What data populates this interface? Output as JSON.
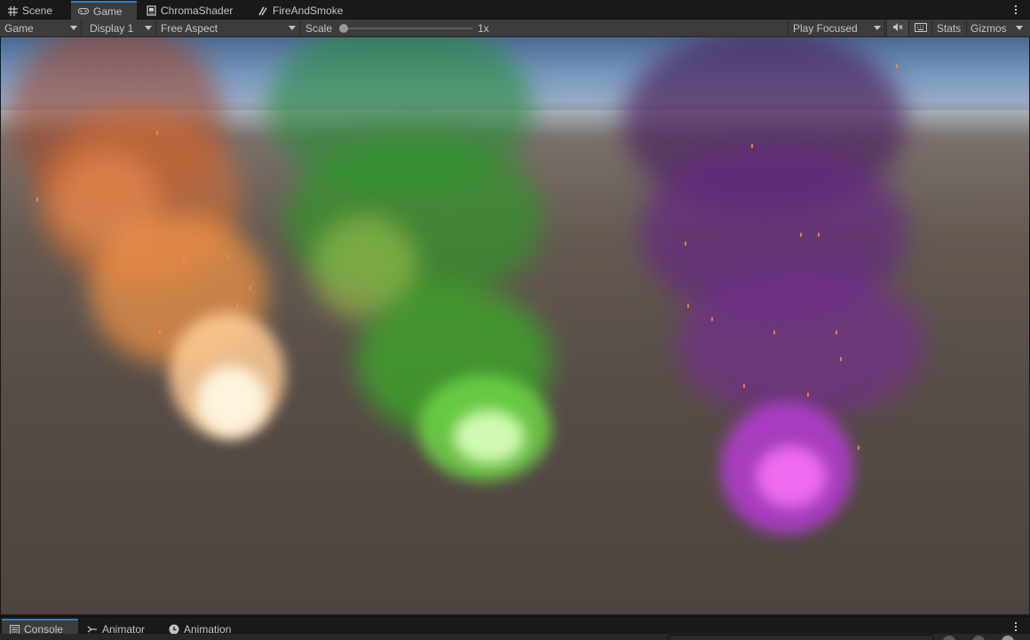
{
  "tabs": [
    {
      "label": "Scene",
      "icon": "grid-icon"
    },
    {
      "label": "Game",
      "icon": "gamepad-icon"
    },
    {
      "label": "ChromaShader",
      "icon": "shader-icon"
    },
    {
      "label": "FireAndSmoke",
      "icon": "particle-icon"
    }
  ],
  "active_tab": "Game",
  "toolbar": {
    "view_mode": "Game",
    "display": "Display 1",
    "aspect": "Free Aspect",
    "scale_label": "Scale",
    "scale_value": "1x",
    "play_mode": "Play Focused",
    "stats_label": "Stats",
    "gizmos_label": "Gizmos"
  },
  "bottom_tabs": [
    {
      "label": "Console",
      "icon": "console-icon"
    },
    {
      "label": "Animator",
      "icon": "animator-icon"
    },
    {
      "label": "Animation",
      "icon": "animation-clock-icon"
    }
  ],
  "colors": {
    "accent": "#3a79bb",
    "fire_orange": "#ff8a3c",
    "smoke_green": "#3fae2c",
    "smoke_purple": "#7b2ca0"
  }
}
